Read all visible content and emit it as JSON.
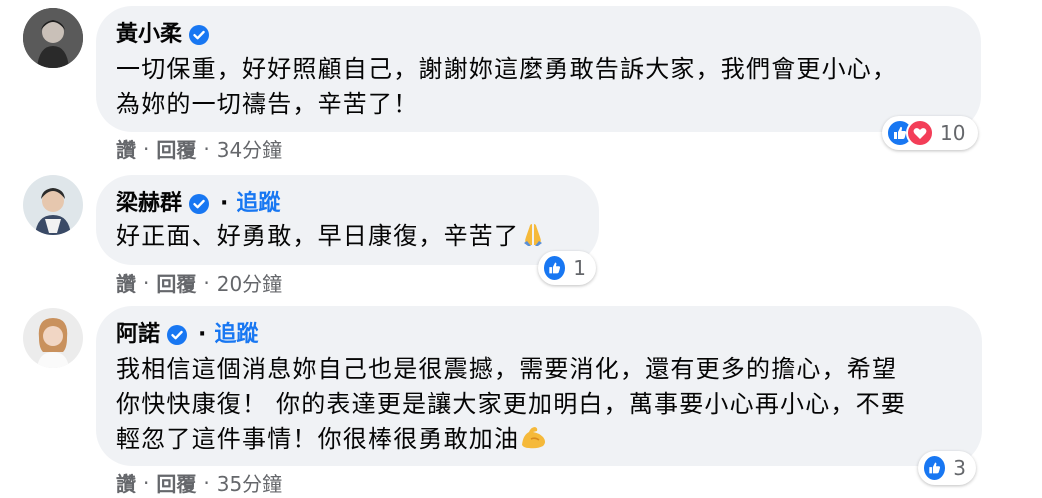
{
  "colors": {
    "bubble": "#f0f2f5",
    "link": "#1877f2",
    "meta": "#65676b",
    "like": "#1877f2",
    "love": "#f33e58"
  },
  "comments": [
    {
      "author": "黃小柔",
      "verified": true,
      "follow_label": "",
      "lines": [
        "一切保重，好好照顧自己，謝謝妳這麼勇敢告訴大家，我們會更小心，",
        "為妳的一切禱告，辛苦了！"
      ],
      "actions": {
        "like": "讚",
        "reply": "回覆",
        "time": "34分鐘",
        "separator": "·"
      },
      "reactions": {
        "icons": [
          "like-icon",
          "love-icon"
        ],
        "count": "10"
      }
    },
    {
      "author": "梁赫群",
      "verified": true,
      "follow_label": "追蹤",
      "lines": [
        "好正面、好勇敢，早日康復，辛苦了"
      ],
      "trailing_emoji": "folded-hands-icon",
      "actions": {
        "like": "讚",
        "reply": "回覆",
        "time": "20分鐘",
        "separator": "·"
      },
      "reactions": {
        "icons": [
          "like-icon"
        ],
        "count": "1"
      }
    },
    {
      "author": "阿諾",
      "verified": true,
      "follow_label": "追蹤",
      "lines": [
        "我相信這個消息妳自己也是很震撼，需要消化，還有更多的擔心，希望",
        "你快快康復！ 你的表達更是讓大家更加明白，萬事要小心再小心，不要",
        "輕忽了這件事情！你很棒很勇敢加油"
      ],
      "trailing_emoji": "flexed-biceps-icon",
      "actions": {
        "like": "讚",
        "reply": "回覆",
        "time": "35分鐘",
        "separator": "·"
      },
      "reactions": {
        "icons": [
          "like-icon"
        ],
        "count": "3"
      }
    }
  ]
}
